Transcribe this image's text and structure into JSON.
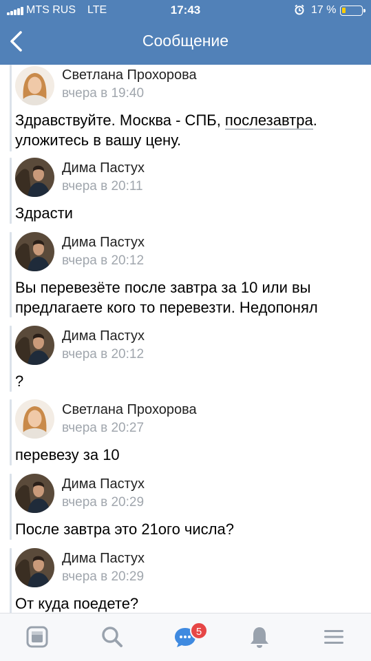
{
  "status_bar": {
    "carrier": "MTS RUS",
    "network": "LTE",
    "time": "17:43",
    "battery": "17 %",
    "battery_level": 0.17
  },
  "header": {
    "title": "Сообщение",
    "back_icon": "chevron-left-icon"
  },
  "messages": [
    {
      "author": "Светлана Прохорова",
      "time": "вчера в 19:40",
      "line1_a": "Здравствуйте. Москва - СПБ, ",
      "line1_link": "послезавтра",
      "line1_b": ".",
      "line2": "уложитесь в вашу цену."
    },
    {
      "author": "Дима Пастух",
      "time": "вчера в 20:11",
      "line1": "Здрасти"
    },
    {
      "author": "Дима Пастух",
      "time": "вчера в 20:12",
      "line1": "Вы перевезёте после завтра за 10 или вы",
      "line2": "предлагаете кого то перевезти. Недопонял"
    },
    {
      "author": "Дима Пастух",
      "time": "вчера в 20:12",
      "line1": "?"
    },
    {
      "author": "Светлана Прохорова",
      "time": "вчера в 20:27",
      "line1": "перевезу за 10"
    },
    {
      "author": "Дима Пастух",
      "time": "вчера в 20:29",
      "line1": "После завтра это 21ого числа?"
    },
    {
      "author": "Дима Пастух",
      "time": "вчера в 20:29",
      "line1": "От куда поедете?"
    }
  ],
  "tabbar": {
    "items": [
      "news-icon",
      "search-icon",
      "messages-icon",
      "bell-icon",
      "menu-icon"
    ],
    "messages_badge": "5"
  },
  "colors": {
    "header_bg": "#5181b8",
    "time_gray": "#a0a6ad",
    "badge_red": "#e64646",
    "tab_icon_gray": "#99a2ad",
    "tab_active_blue": "#3f8ae0"
  }
}
